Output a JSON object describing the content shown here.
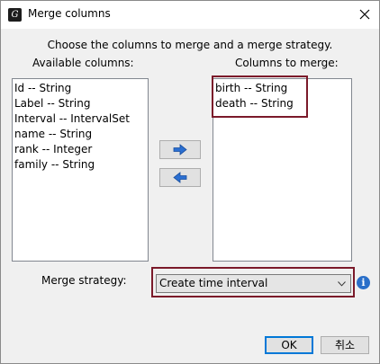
{
  "window": {
    "title": "Merge columns",
    "icon": "app-logo-icon",
    "close_icon": "close-icon"
  },
  "instructions": "Choose the columns to merge and a merge strategy.",
  "available": {
    "label": "Available columns:",
    "items": [
      "Id -- String",
      "Label -- String",
      "Interval -- IntervalSet",
      "name -- String",
      "rank -- Integer",
      "family -- String"
    ]
  },
  "selected": {
    "label": "Columns to merge:",
    "items": [
      "birth -- String",
      "death -- String"
    ]
  },
  "move_buttons": {
    "add_icon": "arrow-right-icon",
    "remove_icon": "arrow-left-icon"
  },
  "strategy": {
    "label": "Merge strategy:",
    "value": "Create time interval",
    "info_icon": "info-icon"
  },
  "buttons": {
    "ok": "OK",
    "cancel": "취소"
  },
  "colors": {
    "highlight": "#7b1a2a",
    "arrow": "#2b6fd1",
    "info": "#2a6fc9",
    "default_button_border": "#0078d7"
  }
}
